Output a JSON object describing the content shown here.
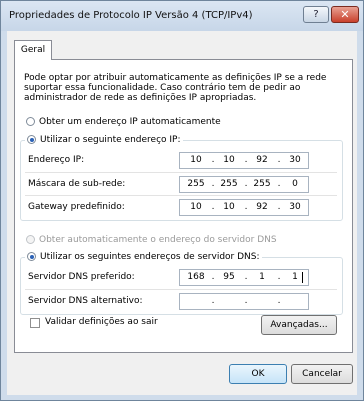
{
  "window": {
    "title": "Propriedades de Protocolo IP Versão 4 (TCP/IPv4)",
    "help_label": "?",
    "close_label": "✕"
  },
  "tab": {
    "label": "Geral"
  },
  "description": "Pode optar por atribuir automaticamente as definições IP se a rede suportar essa funcionalidade. Caso contrário tem de pedir ao administrador de rede as definições IP apropriadas.",
  "ip": {
    "auto_label": "Obter um endereço IP automaticamente",
    "manual_label": "Utilizar o seguinte endereço IP:",
    "address": {
      "label": "Endereço IP:",
      "octets": [
        "10",
        "10",
        "92",
        "30"
      ]
    },
    "mask": {
      "label": "Máscara de sub-rede:",
      "octets": [
        "255",
        "255",
        "255",
        "0"
      ]
    },
    "gateway": {
      "label": "Gateway predefinido:",
      "octets": [
        "10",
        "10",
        "92",
        "30"
      ]
    }
  },
  "dns": {
    "auto_label": "Obter automaticamente o endereço do servidor DNS",
    "manual_label": "Utilizar os seguintes endereços de servidor DNS:",
    "preferred": {
      "label": "Servidor DNS preferido:",
      "octets": [
        "168",
        "95",
        "1",
        "1"
      ]
    },
    "alternate": {
      "label": "Servidor DNS alternativo:",
      "octets": [
        "",
        "",
        "",
        ""
      ]
    }
  },
  "validate_label": "Validar definições ao sair",
  "buttons": {
    "advanced": "Avançadas...",
    "ok": "OK",
    "cancel": "Cancelar"
  },
  "separator": "."
}
